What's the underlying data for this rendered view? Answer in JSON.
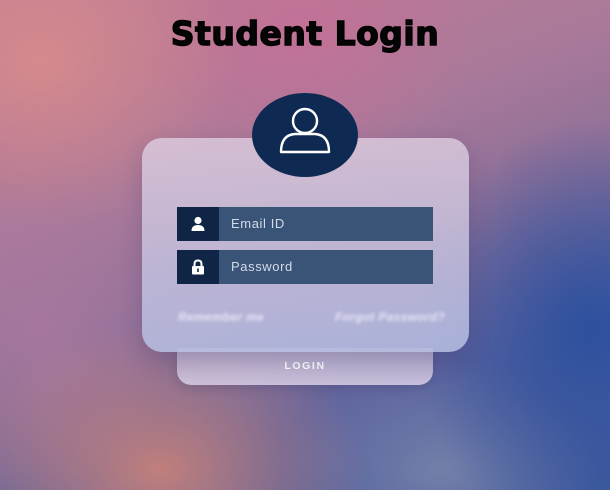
{
  "page": {
    "title": "Student Login"
  },
  "form": {
    "email_placeholder": "Email ID",
    "password_placeholder": "Password",
    "login_label": "LOGIN",
    "left_link": "Remember me",
    "right_link": "Forgot Password?"
  },
  "icons": {
    "avatar": "user-outline-icon",
    "email": "user-icon",
    "password": "lock-icon"
  },
  "colors": {
    "avatar_bg": "#0f2a52",
    "field_bg": "#3a5478",
    "icon_box_bg": "#102546",
    "title_color": "#050505"
  }
}
